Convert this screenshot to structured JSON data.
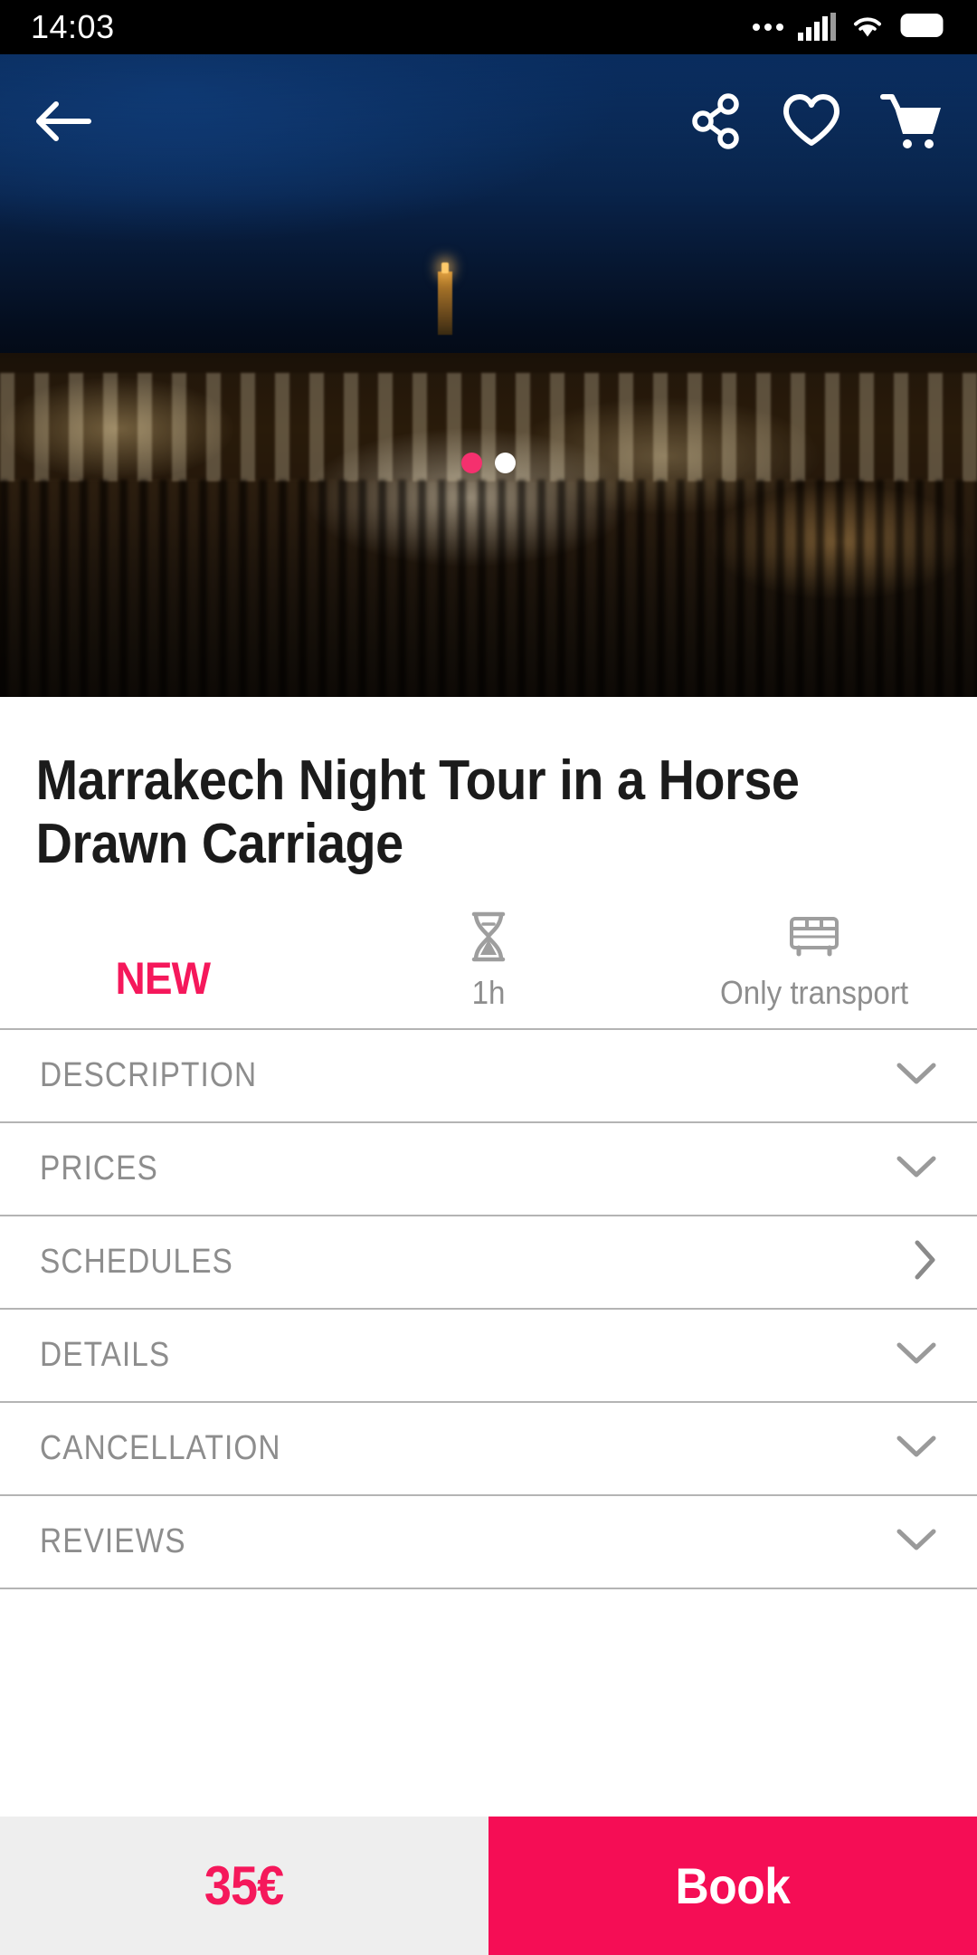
{
  "status_bar": {
    "time": "14:03",
    "icons": [
      "more-dots-icon",
      "cellular-signal-icon",
      "wifi-icon",
      "battery-icon"
    ]
  },
  "top_nav": {
    "back_icon": "back-arrow-icon",
    "share_icon": "share-icon",
    "favorite_icon": "heart-icon",
    "cart_icon": "shopping-cart-icon"
  },
  "hero": {
    "carousel": {
      "total": 2,
      "active_index": 0,
      "active_color": "#f5306e",
      "inactive_color": "#ffffff"
    }
  },
  "product": {
    "title": "Marrakech Night Tour in a Horse Drawn Carriage",
    "badges": [
      {
        "type": "text",
        "label": "NEW",
        "color": "#f5185b",
        "icon": ""
      },
      {
        "type": "icon",
        "label": "1h",
        "icon": "hourglass-icon",
        "color": "#8e8e8e"
      },
      {
        "type": "icon",
        "label": "Only transport",
        "icon": "bus-icon",
        "color": "#8e8e8e"
      }
    ]
  },
  "sections": [
    {
      "label": "DESCRIPTION",
      "chevron": "chevron-down-icon"
    },
    {
      "label": "PRICES",
      "chevron": "chevron-down-icon"
    },
    {
      "label": "SCHEDULES",
      "chevron": "chevron-right-icon"
    },
    {
      "label": "DETAILS",
      "chevron": "chevron-down-icon"
    },
    {
      "label": "CANCELLATION",
      "chevron": "chevron-down-icon"
    },
    {
      "label": "REVIEWS",
      "chevron": "chevron-down-icon"
    }
  ],
  "bottom_bar": {
    "price": "35€",
    "book_label": "Book",
    "price_color": "#f5185b",
    "book_bg": "#f50d55",
    "price_bg": "#eeeeee"
  }
}
